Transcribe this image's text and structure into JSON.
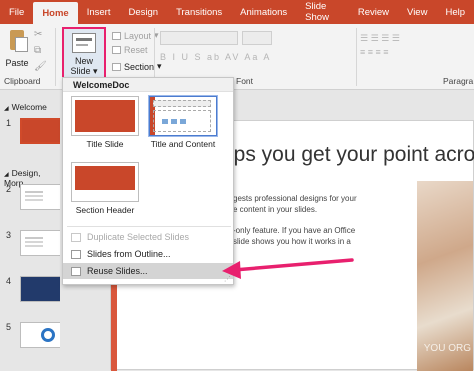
{
  "tabs": [
    "File",
    "Home",
    "Insert",
    "Design",
    "Transitions",
    "Animations",
    "Slide Show",
    "Review",
    "View",
    "Help"
  ],
  "ribbon": {
    "paste_label": "Paste",
    "clipboard_label": "Clipboard",
    "new_slide_label": "New Slide",
    "layout_label": "Layout",
    "reset_label": "Reset",
    "section_label": "Section",
    "font_group_label": "Font",
    "paragraph_group_label": "Paragra"
  },
  "thumbnails": {
    "section1": "Welcome",
    "section2": "Design, Morp",
    "slide_numbers": [
      "1",
      "2",
      "3",
      "4",
      "5"
    ]
  },
  "slide": {
    "title": "lps you get your point across",
    "body1_line1": "gests professional designs for your",
    "body1_line2": "e content in your slides.",
    "body2_line1": "-only feature. If you have an Office",
    "body2_line2": "slide shows you how it works in a",
    "photo_text": "YOU ORG"
  },
  "menu": {
    "header": "WelcomeDoc",
    "layouts": [
      "Title Slide",
      "Title and Content",
      "Section Header"
    ],
    "items": [
      "Duplicate Selected Slides",
      "Slides from Outline...",
      "Reuse Slides..."
    ]
  },
  "colors": {
    "accent": "#c9472a",
    "highlight": "#e8206e"
  }
}
